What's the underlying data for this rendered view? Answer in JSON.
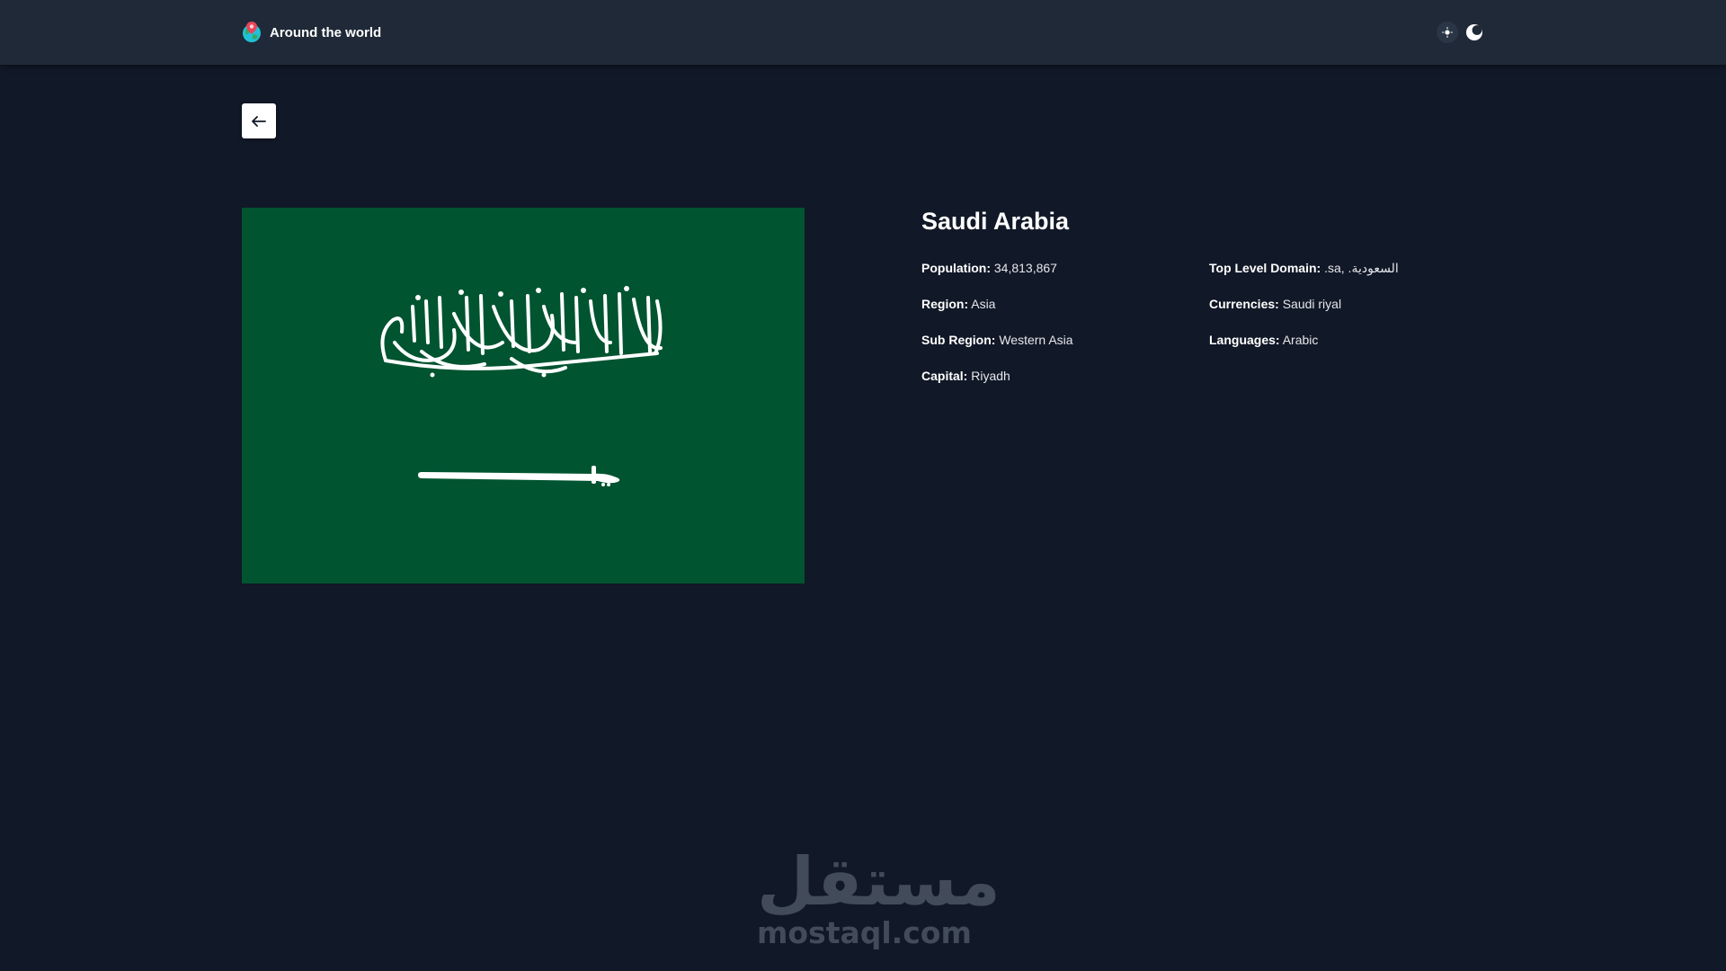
{
  "app": {
    "title": "Around the world",
    "logo_icon": "globe-pin-icon"
  },
  "theme_toggle": {
    "light_icon": "sun-icon",
    "dark_icon": "moon-icon"
  },
  "back_button": {
    "icon": "arrow-left-icon"
  },
  "flag": {
    "country": "Saudi Arabia",
    "background_color": "#005430",
    "emblem_color": "#ffffff",
    "icon": "saudi-flag-shahada-sword"
  },
  "country": {
    "name": "Saudi Arabia",
    "details_left": [
      {
        "label": "Population:",
        "value": "34,813,867"
      },
      {
        "label": "Region:",
        "value": "Asia"
      },
      {
        "label": "Sub Region:",
        "value": "Western Asia"
      },
      {
        "label": "Capital:",
        "value": "Riyadh"
      }
    ],
    "details_right": [
      {
        "label": "Top Level Domain:",
        "value": ".sa, .السعودية"
      },
      {
        "label": "Currencies:",
        "value": "Saudi riyal"
      },
      {
        "label": "Languages:",
        "value": "Arabic"
      }
    ]
  },
  "watermark": {
    "arabic": "مستقل",
    "latin": "mostaql.com"
  },
  "colors": {
    "background": "#111827",
    "navbar": "#1f2937",
    "text": "#ffffff"
  }
}
